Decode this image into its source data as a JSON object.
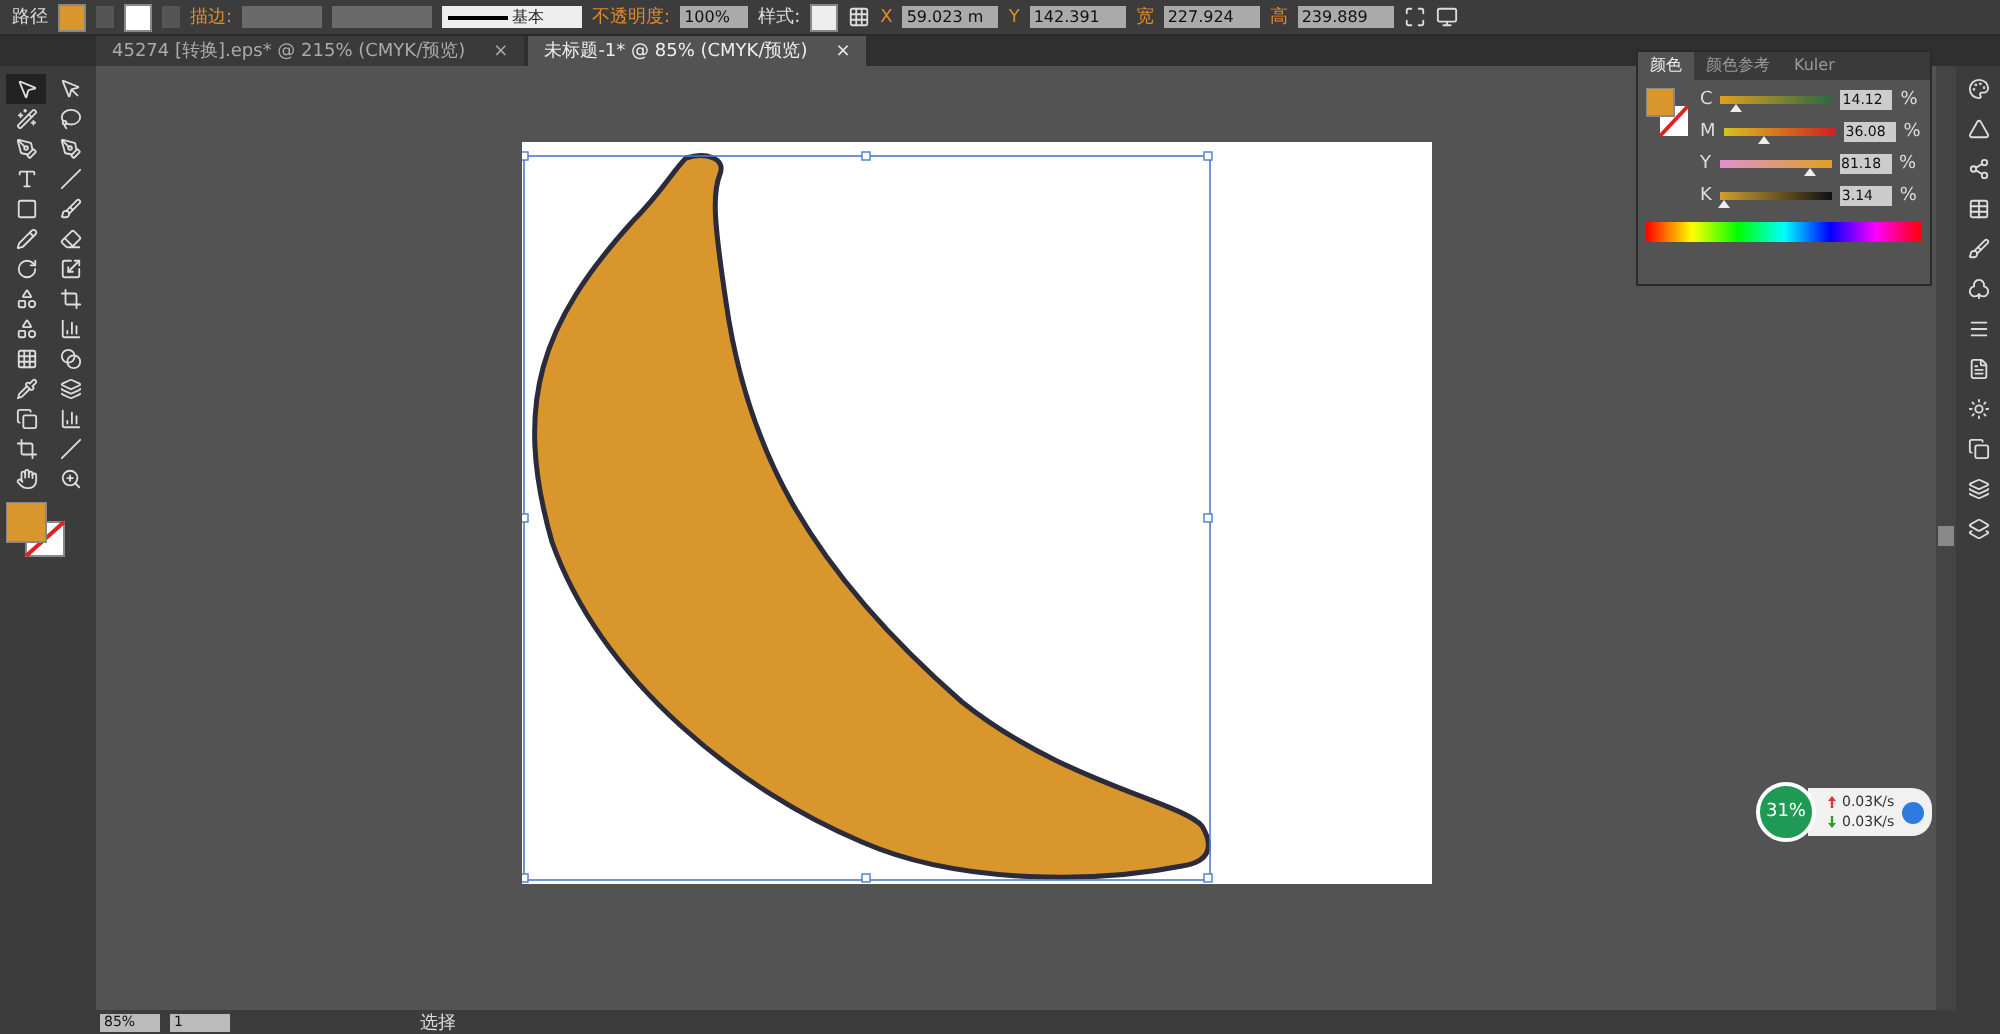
{
  "control_bar": {
    "object_type": "路径",
    "stroke_label": "描边:",
    "brush": "基本",
    "opacity_label": "不透明度:",
    "opacity": "100%",
    "style_label": "样式:",
    "transform": [
      {
        "label": "X",
        "value": "59.023 m"
      },
      {
        "label": "Y",
        "value": "142.391"
      },
      {
        "label": "宽",
        "value": "227.924"
      },
      {
        "label": "高",
        "value": "239.889"
      }
    ]
  },
  "tabs": [
    {
      "label": "45274 [转换].eps* @ 215% (CMYK/预览)",
      "close": "×",
      "selected": false
    },
    {
      "label": "未标题-1* @ 85% (CMYK/预览)",
      "close": "×",
      "selected": true
    }
  ],
  "color_panel": {
    "tabs": [
      {
        "label": "颜色",
        "selected": true
      },
      {
        "label": "颜色参考",
        "selected": false
      },
      {
        "label": "Kuler",
        "selected": false
      }
    ],
    "channels": [
      {
        "name": "C",
        "level": 0.14,
        "value": "14.12",
        "unit": "%"
      },
      {
        "name": "M",
        "level": 0.36,
        "value": "36.08",
        "unit": "%"
      },
      {
        "name": "Y",
        "level": 0.81,
        "value": "81.18",
        "unit": "%"
      },
      {
        "name": "K",
        "level": 0.03,
        "value": "3.14",
        "unit": "%"
      }
    ]
  },
  "network_widget": {
    "percent": "31%",
    "upload": "0.03K/s",
    "download": "0.03K/s"
  },
  "status_bar": {
    "zoom": "85%",
    "page": "1",
    "tool": "选择"
  }
}
